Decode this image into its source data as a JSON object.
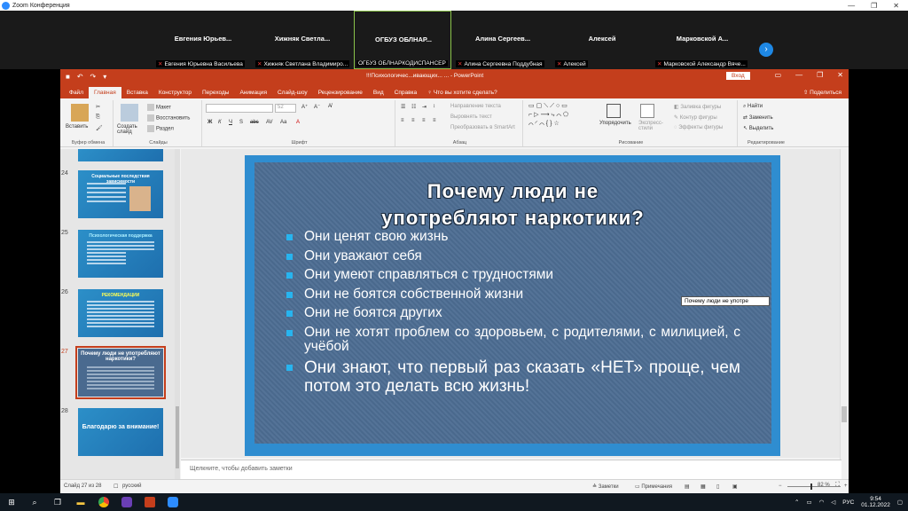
{
  "zoom": {
    "window_title": "Zoom Конференция",
    "participants": [
      {
        "display": "Евгения Юрьев...",
        "full": "Евгения Юрьевна Васильева",
        "muted": true
      },
      {
        "display": "Хижняк Светла...",
        "full": "Хижняк Светлана Владимиро...",
        "muted": true
      },
      {
        "display": "ОГБУЗ ОБЛНАР...",
        "full": "ОГБУЗ ОБЛНАРКОДИСПАНСЕР",
        "muted": false
      },
      {
        "display": "Алина Сергеев...",
        "full": "Алина Сергеевна Поддубная",
        "muted": true
      },
      {
        "display": "Алексей",
        "full": "Алексей",
        "muted": true
      },
      {
        "display": "Марковской А...",
        "full": "Марковской Александр Вяче...",
        "muted": true
      }
    ]
  },
  "ppt": {
    "doc_title": "!!!Психологичес...ивающих... ... - PowerPoint",
    "signin": "Вход",
    "share": "Поделиться",
    "tabs": [
      "Файл",
      "Главная",
      "Вставка",
      "Конструктор",
      "Переходы",
      "Анимация",
      "Слайд-шоу",
      "Рецензирование",
      "Вид",
      "Справка"
    ],
    "tell_me": "Что вы хотите сделать?",
    "ribbon": {
      "paste": "Вставить",
      "new_slide": "Создать слайд",
      "layout": "Макет",
      "reset": "Восстановить",
      "section": "Раздел",
      "font_size": "52",
      "text_direction": "Направление текста",
      "align_text": "Выровнять текст",
      "smartart": "Преобразовать в SmartArt",
      "arrange": "Упорядочить",
      "quick_styles": "Экспресс-стили",
      "shape_fill": "Заливка фигуры",
      "shape_outline": "Контур фигуры",
      "shape_effects": "Эффекты фигуры",
      "find": "Найти",
      "replace": "Заменить",
      "select": "Выделить",
      "groups": {
        "clipboard": "Буфер обмена",
        "slides": "Слайды",
        "font": "Шрифт",
        "paragraph": "Абзац",
        "drawing": "Рисование",
        "editing": "Редактирование"
      }
    },
    "thumbnails": [
      {
        "num": "24",
        "title": "Социальные последствия зависимости"
      },
      {
        "num": "25",
        "title": "Психологическая поддержка"
      },
      {
        "num": "26",
        "title": "РЕКОМЕНДАЦИИ"
      },
      {
        "num": "27",
        "title": "Почему люди не употребляют наркотики?",
        "current": true
      },
      {
        "num": "28",
        "title": "Благодарю за внимание!"
      }
    ],
    "slide": {
      "title_line1": "Почему люди не",
      "title_line2": "употребляют наркотики?",
      "bullets": [
        "Они ценят свою жизнь",
        "Они уважают себя",
        "Они умеют справляться с трудностями",
        "Они не боятся собственной жизни",
        "Они не боятся других",
        "Они не хотят проблем со здоровьем, с родителями, с милицией, с учёбой",
        "Они знают, что первый раз сказать «НЕТ» проще, чем потом это делать всю жизнь!"
      ]
    },
    "tooltip": "Почему люди не употре",
    "notes_placeholder": "Щелкните, чтобы добавить заметки",
    "status": {
      "slide_info": "Слайд 27 из 28",
      "language": "русский",
      "notes": "Заметки",
      "comments": "Примечания",
      "zoom": "82 %"
    }
  },
  "taskbar": {
    "lang": "РУС",
    "time": "9:54",
    "date": "01.12.2022"
  }
}
